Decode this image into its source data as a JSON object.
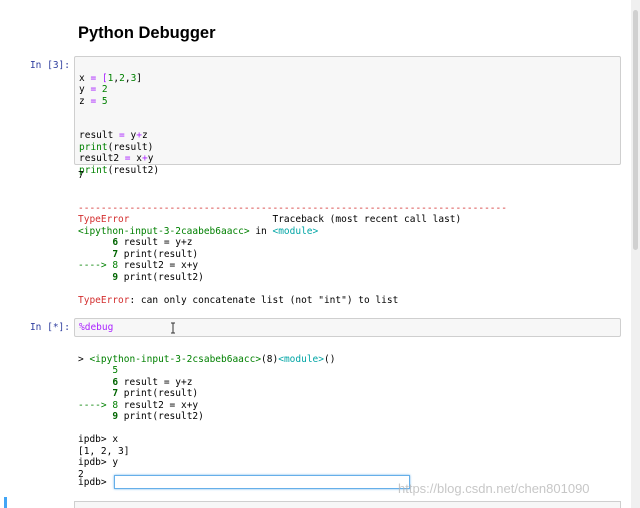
{
  "notebook": {
    "heading": "Python Debugger",
    "cell1": {
      "prompt": "In [3]:",
      "code": {
        "l1": [
          "x",
          " = [",
          "1",
          ",",
          "2",
          ",",
          "3",
          "]"
        ],
        "l2": [
          "y",
          " = ",
          "2"
        ],
        "l3": [
          "z",
          " = ",
          "5"
        ],
        "l4": [
          "result",
          " = ",
          "y",
          "+",
          "z"
        ],
        "l5": [
          "print",
          "(result)"
        ],
        "l6": [
          "result2",
          " = ",
          "x",
          "+",
          "y"
        ],
        "l7": [
          "print",
          "(result2)"
        ]
      },
      "output_value": "7",
      "traceback": {
        "rule": "---------------------------------------------------------------------------",
        "error_name": "TypeError",
        "traceback_label": "Traceback (most recent call last)",
        "module_line": [
          "<ipython-input-3-2caabeb6aacc>",
          " in ",
          "<module>"
        ],
        "lines": [
          {
            "prefix": "      ",
            "no": "6",
            "code": " result = y+z"
          },
          {
            "prefix": "      ",
            "no": "7",
            "code": " print(result)"
          },
          {
            "prefix": "----> ",
            "no": "8",
            "code": " result2 = x+y"
          },
          {
            "prefix": "      ",
            "no": "9",
            "code": " print(result2)"
          }
        ],
        "error_message_name": "TypeError",
        "error_message": ": can only concatenate list (not \"int\") to list"
      }
    },
    "cell2": {
      "prompt": "In [*]:",
      "code": "%debug",
      "debug_header": [
        ">",
        " <ipython-input-3-2csabeb6aacc>",
        "(8)",
        "<module>",
        "()"
      ],
      "debug_lines": [
        {
          "prefix": "      ",
          "no": "5",
          "code": ""
        },
        {
          "prefix": "      ",
          "no": "6",
          "code": " result = y+z"
        },
        {
          "prefix": "      ",
          "no": "7",
          "code": " print(result)"
        },
        {
          "prefix": "----> ",
          "no": "8",
          "code": " result2 = x+y"
        },
        {
          "prefix": "      ",
          "no": "9",
          "code": " print(result2)"
        }
      ],
      "session": [
        "ipdb> x",
        "[1, 2, 3]",
        "ipdb> y",
        "2"
      ],
      "input_prompt": "ipdb>",
      "input_value": ""
    }
  },
  "watermark": "https://blog.csdn.net/chen801090",
  "colors": {
    "prompt": "#303f9f",
    "error": "#d32f2f",
    "cyan": "#00a5a5",
    "green": "#008000",
    "operator": "#aa22ff"
  },
  "icons": {
    "cursor": "text-cursor-icon"
  }
}
